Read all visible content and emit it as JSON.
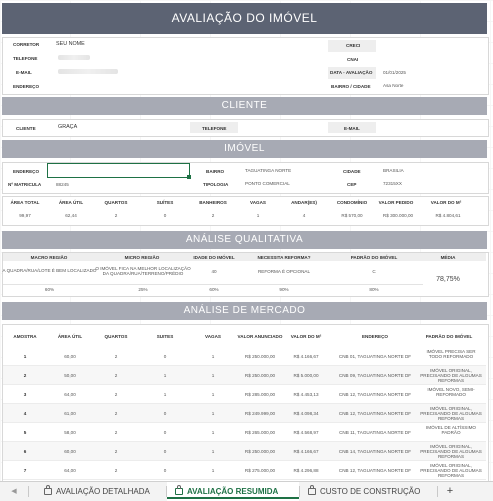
{
  "title": "AVALIAÇÃO DO IMÓVEL",
  "header": {
    "corretor_label": "CORRETOR",
    "corretor_value": "SEU NOME",
    "telefone_label": "TELEFONE",
    "email_label": "E-MAIL",
    "endereco_label": "ENDEREÇO",
    "creci_label": "CRECI",
    "cnai_label": "CNAI",
    "data_label": "DATA - AVALIAÇÃO",
    "data_value": "01/01/2025",
    "bairro_cidade_label": "BAIRRO / CIDADE",
    "bairro_cidade_value": "Asa Norte"
  },
  "cliente": {
    "section_title": "CLIENTE",
    "cliente_label": "CLIENTE",
    "cliente_value": "GRAÇA",
    "telefone_label": "TELEFONE",
    "email_label": "E-MAIL"
  },
  "imovel": {
    "section_title": "IMÓVEL",
    "endereco_label": "ENDEREÇO",
    "bairro_label": "BAIRRO",
    "bairro_value": "TAGUATINGA NORTE",
    "cidade_label": "CIDADE",
    "cidade_value": "BRASILIA",
    "matricula_label": "Nº MATRICULA",
    "matricula_value": "88245",
    "tipologia_label": "TIPOLOGIA",
    "tipologia_value": "PONTO COMERCIAL",
    "cep_label": "CEP",
    "cep_value": "72315XX",
    "columns": [
      "ÁREA TOTAL",
      "ÁREA ÚTIL",
      "QUARTOS",
      "SUÍTES",
      "BANHEIROS",
      "VAGAS",
      "ANDAR(ES)",
      "CONDOMÍNIO",
      "VALOR PEDIDO",
      "VALOR DO M²"
    ],
    "values": [
      "99,97",
      "62,44",
      "2",
      "0",
      "2",
      "1",
      "4",
      "R$ 570,00",
      "R$ 300.000,00",
      "R$ 4.804,61"
    ]
  },
  "qualitativa": {
    "section_title": "ANÁLISE QUALITATIVA",
    "columns": [
      "MACRO REGIÃO",
      "MICRO REGIÃO",
      "IDADE DO IMÓVEL",
      "NECESSITA REFORMA?",
      "PADRÃO DO IMÓVEL",
      "MÉDIA"
    ],
    "values": [
      "A QUADRA/RUA/LOTE É BEM LOCALIZADO",
      "O IMÓVEL FICA NA MELHOR LOCALIZAÇÃO DA QUADRA/RUA/TERRENO/PRÉDIO",
      "40",
      "REFORMA É OPCIONAL",
      "C"
    ],
    "percents": [
      "60%",
      "25%",
      "60%",
      "90%",
      "80%"
    ],
    "media": "78,75%"
  },
  "mercado": {
    "section_title": "ANÁLISE DE MERCADO",
    "columns": [
      "AMOSTRA",
      "ÁREA ÚTIL",
      "QUARTOS",
      "SUITES",
      "VAGAS",
      "VALOR ANUNCIADO",
      "VALOR DO M²",
      "ENDEREÇO",
      "PADRÃO DO IMÓVEL"
    ],
    "rows": [
      [
        "1",
        "60,00",
        "2",
        "0",
        "1",
        "R$ 250.000,00",
        "R$ 4.166,67",
        "CNB 01, TAGUATINGA NORTE DF",
        "IMÓVEL PRECISA SER TODO REFORMADO"
      ],
      [
        "2",
        "50,00",
        "2",
        "1",
        "1",
        "R$ 250.000,00",
        "R$ 5.000,00",
        "CNB 09, TAGUATINGA NORTE DF",
        "IMÓVEL ORIGINAL, PRECISANDO DE ALGUMAS REFORMAS"
      ],
      [
        "3",
        "64,00",
        "2",
        "1",
        "1",
        "R$ 285.000,00",
        "R$ 4.453,13",
        "CNB 12, TAGUATINGA NORTE DF",
        "IMÓVEL NOVO, SEMI-REFORMADO"
      ],
      [
        "4",
        "61,00",
        "2",
        "0",
        "1",
        "R$ 249.999,00",
        "R$ 4.098,34",
        "CNB 12, TAGUATINGA NORTE DF",
        "IMÓVEL ORIGINAL, PRECISANDO DE ALGUMAS REFORMAS"
      ],
      [
        "5",
        "58,00",
        "2",
        "0",
        "1",
        "R$ 265.000,00",
        "R$ 4.568,97",
        "CNB 11, TAGUATINGA NORTE DF",
        "IMÓVEL DE ALTÍSSIMO PADRÃO"
      ],
      [
        "6",
        "60,00",
        "2",
        "0",
        "1",
        "R$ 250.000,00",
        "R$ 4.166,67",
        "CNB 14, TAGUATINGA NORTE DF",
        "IMÓVEL ORIGINAL, PRECISANDO DE ALGUMAS REFORMAS"
      ],
      [
        "7",
        "64,00",
        "2",
        "0",
        "1",
        "R$ 275.000,00",
        "R$ 4.296,88",
        "CNB 12, TAGUATINGA NORTE DF",
        "IMÓVEL ORIGINAL, PRECISANDO DE ALGUMAS REFORMAS"
      ]
    ]
  },
  "tabs": {
    "prev_label": "◀",
    "detalhada": "AVALIAÇÃO DETALHADA",
    "resumida": "AVALIAÇÃO RESUMIDA",
    "custo": "CUSTO DE CONSTRUÇÃO",
    "add": "+"
  }
}
